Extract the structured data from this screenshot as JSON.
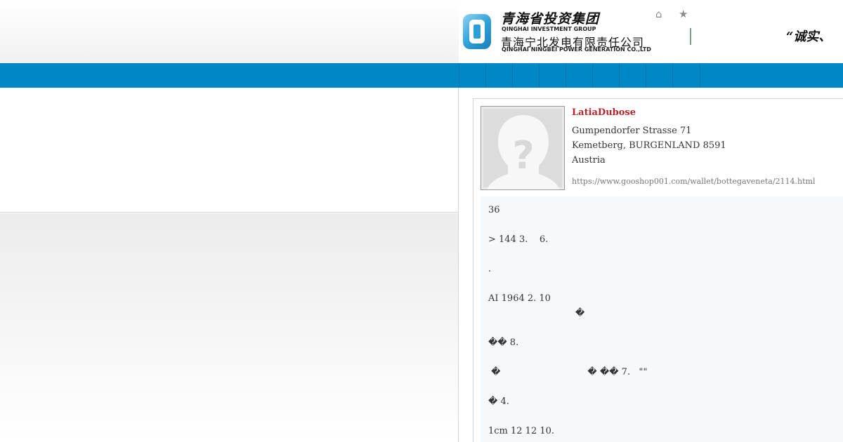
{
  "header": {
    "logo_cn_group": "青海省投资集团",
    "logo_en_group": "QINGHAI INVESTMENT GROUP",
    "logo_cn_company": "青海宁北发电有限责任公司",
    "logo_en_company": "QINGHAI NINGBEI POWER GENERATION CO.,LTD",
    "home_icon": "⌂",
    "favorite_icon": "★",
    "slogan": "“诚实、"
  },
  "nav": {
    "items": [
      "",
      "",
      "",
      "",
      "",
      "",
      "",
      "",
      ""
    ]
  },
  "profile": {
    "name": "LatiaDubose",
    "address_line1": "Gumpendorfer Strasse 71",
    "address_line2": "Kemetberg, BURGENLAND 8591",
    "country": "Austria",
    "url": "https://www.gooshop001.com/wallet/bottegaveneta/2114.html"
  },
  "post": {
    "lines": [
      "36",
      "> 144 3.    6.",
      ".",
      "AI 1964 2. 10",
      "                              �",
      "�� 8.",
      " �                              � �� 7.   \"\"",
      "� 4.",
      "1cm 12 12 10."
    ]
  },
  "colors": {
    "nav_blue": "#0088c6",
    "name_red": "#b4262c",
    "post_bg": "#f5f9fc"
  }
}
